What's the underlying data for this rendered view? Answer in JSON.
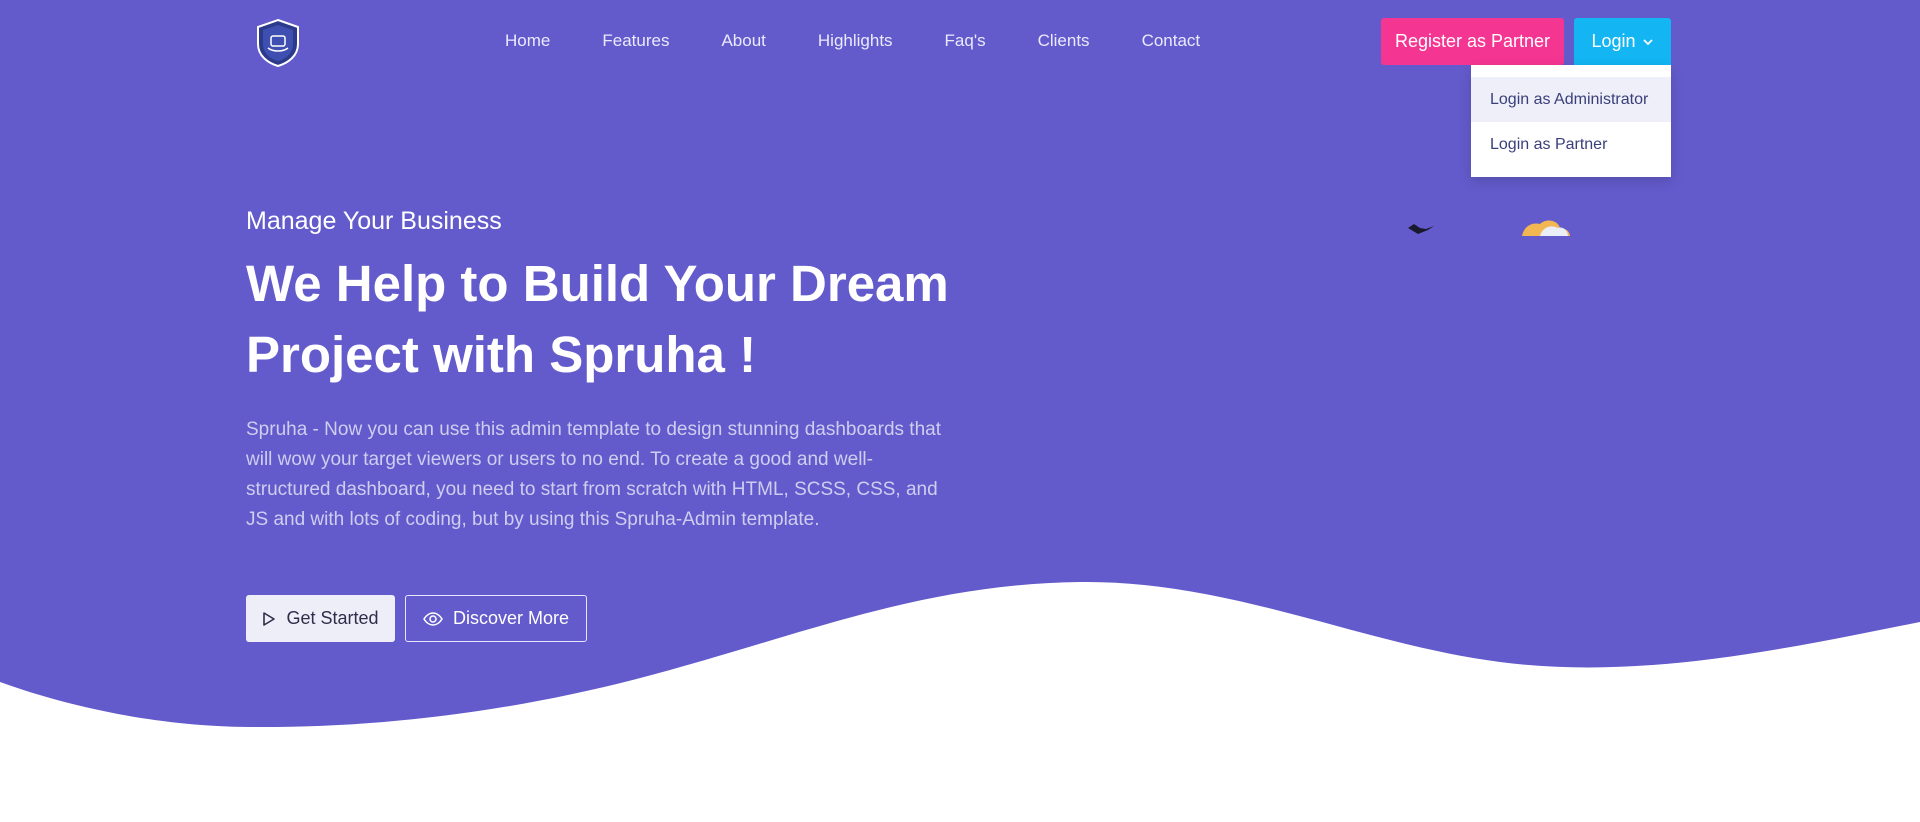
{
  "colors": {
    "hero_bg": "#635bcb",
    "register_btn": "#f53592",
    "login_btn": "#13b5f2",
    "dropdown_text": "#3a3f7a"
  },
  "header": {
    "logo_icon": "shield-logo-icon",
    "nav": [
      "Home",
      "Features",
      "About",
      "Highlights",
      "Faq's",
      "Clients",
      "Contact"
    ],
    "register_label": "Register as Partner",
    "login_label": "Login",
    "login_dropdown": [
      "Login as Administrator",
      "Login as Partner"
    ]
  },
  "hero": {
    "subtitle": "Manage Your Business",
    "title": "We Help to Build Your Dream Project with Spruha !",
    "description": "Spruha - Now you can use this admin template to design stunning dashboards that will wow your target viewers or users to no end. To create a good and well-structured dashboard, you need to start from scratch with HTML, SCSS, CSS, and JS and with lots of coding, but by using this Spruha-Admin template.",
    "get_started_label": "Get Started",
    "discover_more_label": "Discover More",
    "get_started_icon": "play-icon",
    "discover_icon": "eye-icon"
  }
}
